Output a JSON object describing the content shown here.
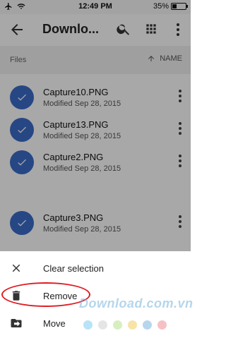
{
  "status_bar": {
    "time": "12:49 PM",
    "battery": "35%",
    "battery_level": 0.35
  },
  "toolbar": {
    "title": "Downlo..."
  },
  "section": {
    "label": "Files",
    "sort_label": "NAME"
  },
  "files": [
    {
      "name": "Capture10.PNG",
      "modified": "Modified Sep 28, 2015"
    },
    {
      "name": "Capture13.PNG",
      "modified": "Modified Sep 28, 2015"
    },
    {
      "name": "Capture2.PNG",
      "modified": "Modified Sep 28, 2015"
    },
    {
      "name": "Capture3.PNG",
      "modified": "Modified Sep 28, 2015"
    }
  ],
  "sheet": {
    "clear_selection": "Clear selection",
    "remove": "Remove",
    "move": "Move"
  },
  "watermark": "Download.com.vn",
  "colors": {
    "check": "#3b6cc8",
    "highlight": "#e01b22",
    "dots": [
      "#b9e3f6",
      "#e5e5e5",
      "#d7efbf",
      "#f7e3a6",
      "#b7d6ee",
      "#f6c1c4"
    ]
  }
}
